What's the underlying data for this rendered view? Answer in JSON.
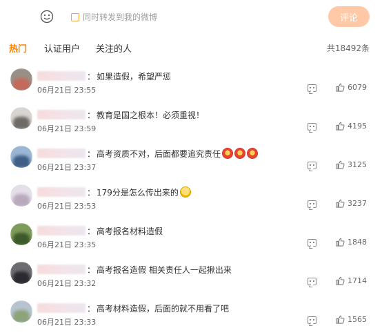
{
  "composer": {
    "repost_label": "同时转发到我的微博",
    "submit_label": "评论"
  },
  "tabs": [
    {
      "label": "热门",
      "active": true
    },
    {
      "label": "认证用户",
      "active": false
    },
    {
      "label": "关注的人",
      "active": false
    }
  ],
  "total": "共18492条",
  "colors": {
    "accent": "#ff8200",
    "submit_bg": "#ffc9a8"
  },
  "comments": [
    {
      "text": "如果造假，希望严惩",
      "time": "06月21日 23:55",
      "likes": "6079",
      "avatar": [
        "#9a8f86",
        "#c46a5c"
      ]
    },
    {
      "text": "教育是国之根本！必须重视！",
      "time": "06月21日 23:59",
      "likes": "4195",
      "avatar": [
        "#d9d4cf",
        "#6f6a66"
      ]
    },
    {
      "text": "高考资质不对，后面都要追究责任",
      "time": "06月21日 23:37",
      "likes": "3125",
      "avatar": [
        "#9bb6d4",
        "#3f5f86"
      ]
    },
    {
      "text": "179分是怎么传出来的",
      "time": "06月21日 23:53",
      "likes": "3237",
      "avatar": [
        "#e4dfe8",
        "#b9a9bc"
      ]
    },
    {
      "text": "高考报名材料造假",
      "time": "06月21日 23:35",
      "likes": "1848",
      "avatar": [
        "#7f9b5c",
        "#3d5a2a"
      ]
    },
    {
      "text": "高考报名造假 相关责任人一起揪出来",
      "time": "06月21日 23:32",
      "likes": "1714",
      "avatar": [
        "#6d6c70",
        "#2a2b31"
      ]
    },
    {
      "text": "高考材料造假，后面的就不用看了吧",
      "time": "06月21日 23:33",
      "likes": "1565",
      "avatar": [
        "#b7c4cf",
        "#8da37a"
      ]
    }
  ]
}
